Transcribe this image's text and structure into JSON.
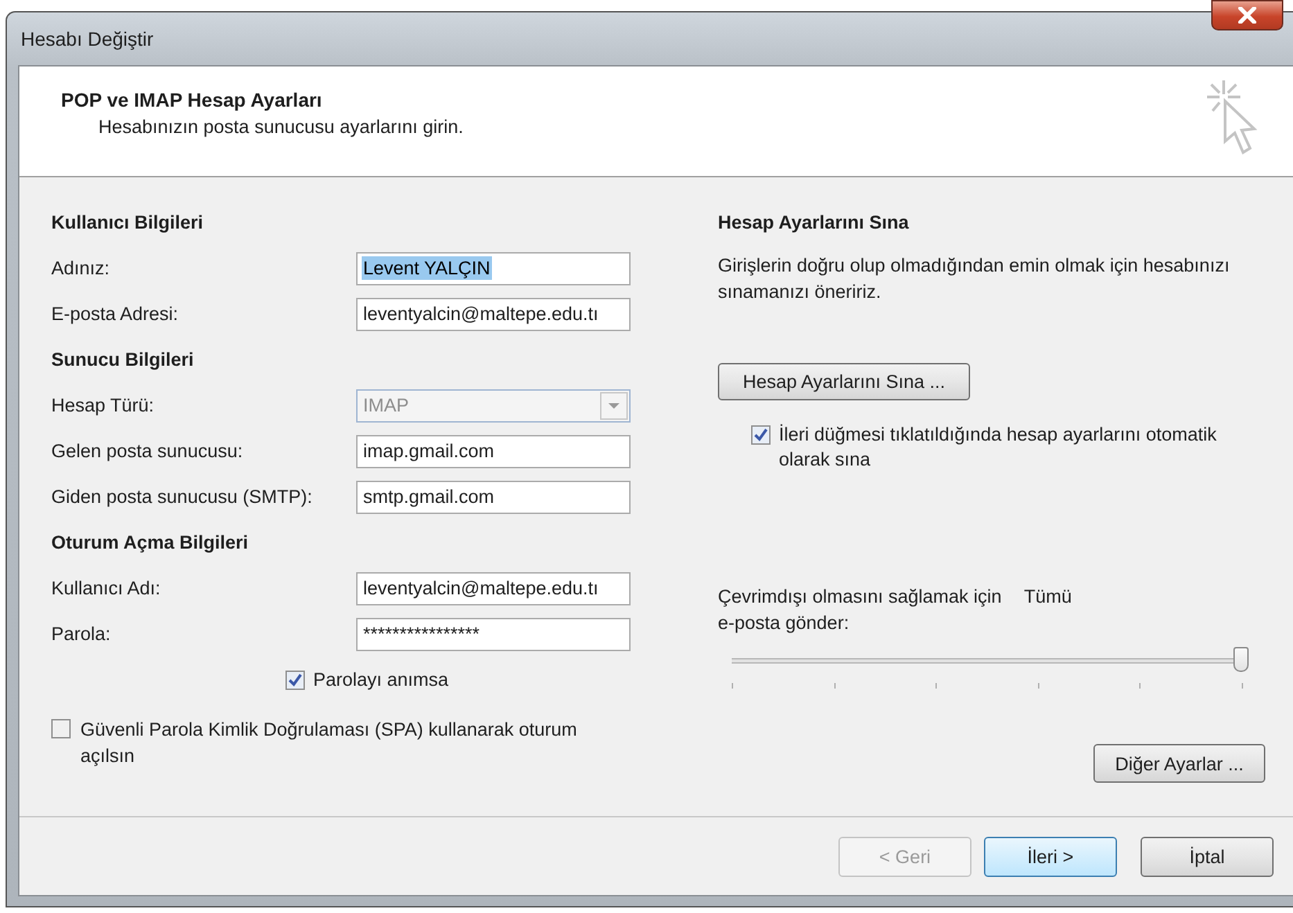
{
  "window": {
    "title": "Hesabı Değiştir"
  },
  "header": {
    "title": "POP ve IMAP Hesap Ayarları",
    "subtitle": "Hesabınızın posta sunucusu ayarlarını girin."
  },
  "left": [
    {
      "kind": "heading",
      "text": "Kullanıcı Bilgileri"
    },
    {
      "kind": "field",
      "label": "Adınız:",
      "value": "Levent YALÇIN",
      "selected": true
    },
    {
      "kind": "field",
      "label": "E-posta Adresi:",
      "value": "leventyalcin@maltepe.edu.tı",
      "selected": false
    },
    {
      "kind": "heading",
      "text": "Sunucu Bilgileri"
    },
    {
      "kind": "combo",
      "label": "Hesap Türü:",
      "value": "IMAP",
      "disabled": true
    },
    {
      "kind": "field",
      "label": "Gelen posta sunucusu:",
      "value": "imap.gmail.com",
      "selected": false
    },
    {
      "kind": "field",
      "label": "Giden posta sunucusu (SMTP):",
      "value": "smtp.gmail.com",
      "selected": false
    },
    {
      "kind": "heading",
      "text": "Oturum Açma Bilgileri"
    },
    {
      "kind": "field",
      "label": "Kullanıcı Adı:",
      "value": "leventyalcin@maltepe.edu.tı",
      "selected": false
    },
    {
      "kind": "field",
      "label": "Parola:",
      "value": "****************",
      "selected": false
    },
    {
      "kind": "checkbox",
      "label": "Parolayı anımsa",
      "checked": true
    }
  ],
  "spa": {
    "label": "Güvenli Parola Kimlik Doğrulaması (SPA) kullanarak oturum açılsın",
    "checked": false
  },
  "test": {
    "heading": "Hesap Ayarlarını Sına",
    "description": "Girişlerin doğru olup olmadığından emin olmak için hesabınızı sınamanızı öneririz.",
    "button": "Hesap Ayarlarını Sına ...",
    "auto_test": {
      "label": "İleri düğmesi tıklatıldığında hesap ayarlarını otomatik olarak sına",
      "checked": true
    }
  },
  "offline": {
    "label": "Çevrimdışı olmasını sağlamak için",
    "reading": "Tümü",
    "label_2": "e-posta gönder:",
    "level": 1
  },
  "more_settings": "Diğer Ayarlar ...",
  "footer": [
    {
      "label": "< Geri",
      "disabled": true,
      "selected": false
    },
    {
      "label": "İleri >",
      "disabled": false,
      "selected": true
    },
    {
      "label": "İptal",
      "disabled": false,
      "selected": false
    }
  ]
}
